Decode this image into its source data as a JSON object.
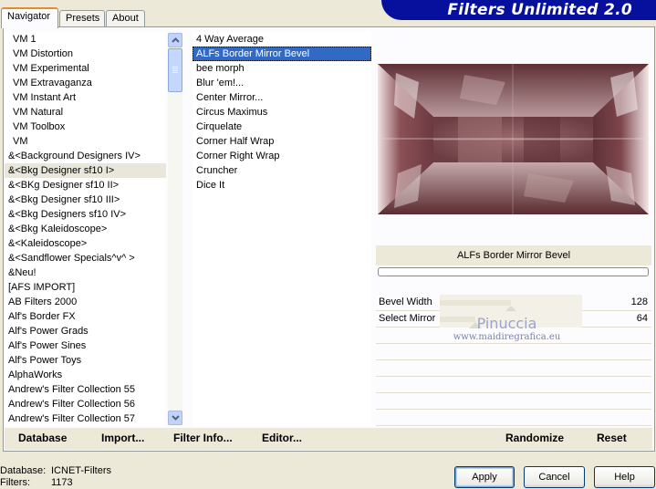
{
  "tabs": {
    "navigator": "Navigator",
    "presets": "Presets",
    "about": "About"
  },
  "banner": {
    "title": "Filters Unlimited 2.0"
  },
  "categories": [
    "VM 1",
    "VM Distortion",
    "VM Experimental",
    "VM Extravaganza",
    "VM Instant Art",
    "VM Natural",
    "VM Toolbox",
    "VM",
    "&<Background Designers IV>",
    "&<Bkg Designer sf10 I>",
    "&<BKg Designer sf10 II>",
    "&<Bkg Designer sf10 III>",
    "&<Bkg Designers sf10 IV>",
    "&<Bkg Kaleidoscope>",
    "&<Kaleidoscope>",
    "&<Sandflower Specials^v^ >",
    "&Neu!",
    "[AFS IMPORT]",
    "AB Filters 2000",
    "Alf's Border FX",
    "Alf's Power Grads",
    "Alf's Power Sines",
    "Alf's Power Toys",
    "AlphaWorks",
    "Andrew's Filter Collection 55",
    "Andrew's Filter Collection 56",
    "Andrew's Filter Collection 57"
  ],
  "filters": [
    "4 Way Average",
    "ALFs Border Mirror Bevel",
    "bee morph",
    "Blur 'em!...",
    "Center Mirror...",
    "Circus Maximus",
    "Cirquelate",
    "Corner Half Wrap",
    "Corner Right Wrap",
    "Cruncher",
    "Dice It"
  ],
  "selected_filter_name": "ALFs Border Mirror Bevel",
  "params": [
    {
      "label": "Bevel Width",
      "value": "128",
      "fraction": 0.502
    },
    {
      "label": "Select Mirror",
      "value": "64",
      "fraction": 0.251
    }
  ],
  "watermark": {
    "line1": "Pinuccia",
    "line2": "www.maidiregrafica.eu"
  },
  "bottom_links": {
    "database": "Database",
    "import": "Import...",
    "filter_info": "Filter Info...",
    "editor": "Editor...",
    "randomize": "Randomize",
    "reset": "Reset"
  },
  "status": {
    "database_label": "Database:",
    "database_value": "ICNET-Filters",
    "filters_label": "Filters:",
    "filters_value": "1173"
  },
  "buttons": {
    "apply": "Apply",
    "cancel": "Cancel",
    "help": "Help"
  },
  "colors": {
    "banner": "#06109c",
    "selection": "#316ac5",
    "preview_base": "#7a4a4f"
  }
}
